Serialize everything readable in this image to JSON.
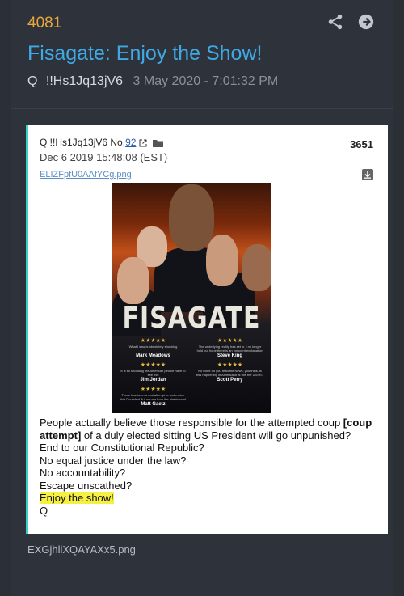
{
  "post": {
    "number": "4081",
    "title": "Fisagate: Enjoy the Show!",
    "author_q": "Q",
    "tripcode": "!!Hs1Jq13jV6",
    "date": "3 May 2020 - 7:01:32 PM",
    "bottom_filename": "EXGjhliXQAYAXx5.png"
  },
  "header_icons": [
    "share-icon",
    "arrow-right-circle-icon"
  ],
  "quoted_post": {
    "author_prefix": "Q !!Hs1Jq13jV6 No.",
    "number_link": "92",
    "post_id": "3651",
    "date": "Dec 6 2019 15:48:08 (EST)",
    "filename": "ELIZFpfU0AAfYCg.png",
    "icons": [
      "external-link-icon",
      "folder-icon",
      "download-icon"
    ],
    "poster": {
      "title": "FISAGATE",
      "quotes": [
        {
          "stars": "★★★★★",
          "text": "What I saw is absolutely shocking",
          "name": "Mark Meadows"
        },
        {
          "stars": "★★★★★",
          "text": "The underlying reality has set in. I no longer hold out hope there is an innocent explanation for the information the public has seen.",
          "name": "Steve King"
        },
        {
          "stars": "★★★★★",
          "text": "It is so shocking the American people have to see this",
          "name": "Jim Jordan"
        },
        {
          "stars": "★★★★★",
          "text": "No more do you read the News, you think, is this happening in America or is this the USSR?",
          "name": "Scott Perry"
        },
        {
          "stars": "★★★★★",
          "text": "There has been a real attempt to undermine this President & it comes from the shadows of places.",
          "name": "Matt Gaetz"
        }
      ]
    },
    "lines": [
      {
        "pre": "People actually believe those responsible for the attempted coup ",
        "bold": "[coup attempt]",
        "post": " of a duly elected sitting US President will go unpunished?"
      },
      {
        "text": "End to our Constitutional Republic?"
      },
      {
        "text": "No equal justice under the law?"
      },
      {
        "text": "No accountability?"
      },
      {
        "text": "Escape unscathed?"
      },
      {
        "text": "Enjoy the show!"
      },
      {
        "text": "Q"
      }
    ]
  },
  "colors": {
    "background": "#2b2f36",
    "post_number": "#e8a83e",
    "title": "#3fa9e6",
    "quote_border": "#3ad1c9",
    "highlight": "#f6f043"
  }
}
